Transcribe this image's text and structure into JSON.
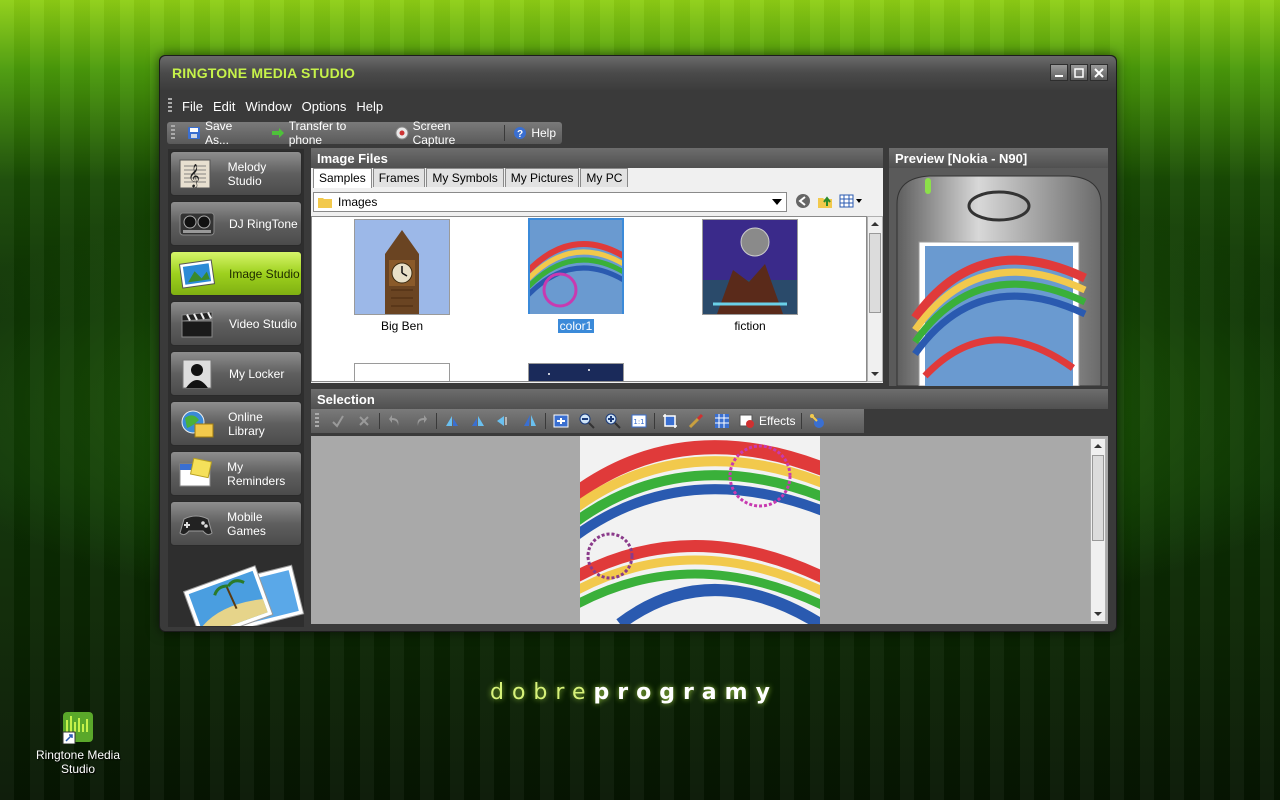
{
  "window": {
    "title": "RINGTONE MEDIA STUDIO",
    "controls": [
      "minimize",
      "maximize",
      "close"
    ]
  },
  "menu": [
    "File",
    "Edit",
    "Window",
    "Options",
    "Help"
  ],
  "toolbar": {
    "save_as": "Save As...",
    "transfer": "Transfer to phone",
    "screen_capture": "Screen Capture",
    "help": "Help"
  },
  "nav": [
    {
      "label": "Melody Studio",
      "icon": "music-note-icon"
    },
    {
      "label": "DJ RingTone",
      "icon": "dj-mixer-icon"
    },
    {
      "label": "Image Studio",
      "icon": "image-icon",
      "active": true
    },
    {
      "label": "Video Studio",
      "icon": "clapperboard-icon"
    },
    {
      "label": "My Locker",
      "icon": "person-silhouette-icon"
    },
    {
      "label": "Online Library",
      "icon": "globe-folder-icon"
    },
    {
      "label": "My Reminders",
      "icon": "calendar-note-icon"
    },
    {
      "label": "Mobile Games",
      "icon": "gamepad-icon"
    }
  ],
  "image_files": {
    "title": "Image Files",
    "tabs": [
      "Samples",
      "Frames",
      "My Symbols",
      "My Pictures",
      "My PC"
    ],
    "selected_tab": "Samples",
    "path": "Images",
    "items": [
      {
        "label": "Big Ben"
      },
      {
        "label": "color1",
        "selected": true
      },
      {
        "label": "fiction"
      }
    ]
  },
  "preview": {
    "title": "Preview [Nokia - N90]"
  },
  "selection": {
    "title": "Selection",
    "effects_label": "Effects"
  },
  "brand": {
    "prefix": "dobre",
    "suffix": "programy"
  },
  "desktop_icon": {
    "label": "Ringtone Media Studio"
  },
  "colors": {
    "accent": "#9ed11e",
    "title_text": "#c6f24a",
    "selection": "#3b8ad9"
  }
}
